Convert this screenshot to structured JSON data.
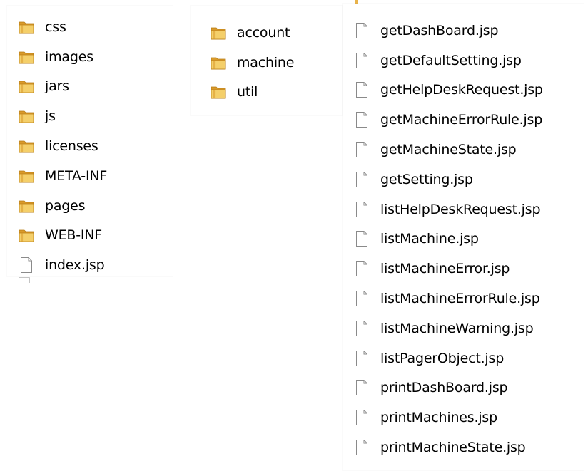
{
  "left_panel": {
    "items": [
      {
        "name": "css",
        "type": "folder"
      },
      {
        "name": "images",
        "type": "folder"
      },
      {
        "name": "jars",
        "type": "folder"
      },
      {
        "name": "js",
        "type": "folder"
      },
      {
        "name": "licenses",
        "type": "folder"
      },
      {
        "name": "META-INF",
        "type": "folder"
      },
      {
        "name": "pages",
        "type": "folder"
      },
      {
        "name": "WEB-INF",
        "type": "folder"
      },
      {
        "name": "index.jsp",
        "type": "file"
      }
    ]
  },
  "middle_panel": {
    "items": [
      {
        "name": "account",
        "type": "folder"
      },
      {
        "name": "machine",
        "type": "folder"
      },
      {
        "name": "util",
        "type": "folder"
      }
    ]
  },
  "right_panel": {
    "items": [
      {
        "name": "getDashBoard.jsp",
        "type": "file"
      },
      {
        "name": "getDefaultSetting.jsp",
        "type": "file"
      },
      {
        "name": "getHelpDeskRequest.jsp",
        "type": "file"
      },
      {
        "name": "getMachineErrorRule.jsp",
        "type": "file"
      },
      {
        "name": "getMachineState.jsp",
        "type": "file"
      },
      {
        "name": "getSetting.jsp",
        "type": "file"
      },
      {
        "name": "listHelpDeskRequest.jsp",
        "type": "file"
      },
      {
        "name": "listMachine.jsp",
        "type": "file"
      },
      {
        "name": "listMachineError.jsp",
        "type": "file"
      },
      {
        "name": "listMachineErrorRule.jsp",
        "type": "file"
      },
      {
        "name": "listMachineWarning.jsp",
        "type": "file"
      },
      {
        "name": "listPagerObject.jsp",
        "type": "file"
      },
      {
        "name": "printDashBoard.jsp",
        "type": "file"
      },
      {
        "name": "printMachines.jsp",
        "type": "file"
      },
      {
        "name": "printMachineState.jsp",
        "type": "file"
      }
    ]
  },
  "icons": {
    "folder": "folder-icon",
    "file": "file-icon"
  },
  "colors": {
    "folder_back": "#d99a2b",
    "folder_front": "#f4cf6a",
    "folder_edge": "#b87c14",
    "file_outline": "#8a8a8a",
    "file_fill": "#ffffff"
  }
}
